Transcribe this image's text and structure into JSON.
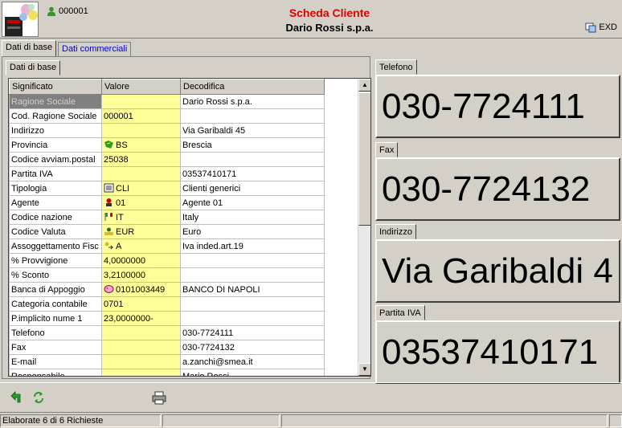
{
  "header": {
    "user_code": "000001",
    "title": "Scheda Cliente",
    "subtitle": "Dario Rossi s.p.a.",
    "exd_label": "EXD"
  },
  "tabs": [
    {
      "label": "Dati di base",
      "active": true
    },
    {
      "label": "Dati commerciali",
      "active": false
    }
  ],
  "left": {
    "subtab": "Dati di base",
    "columns": [
      "Significato",
      "Valore",
      "Decodifica"
    ],
    "rows": [
      {
        "sig": "Ragione Sociale",
        "val": "",
        "dec": "Dario Rossi s.p.a.",
        "icon": ""
      },
      {
        "sig": "Cod. Ragione Sociale",
        "val": "000001",
        "dec": "",
        "icon": ""
      },
      {
        "sig": "Indirizzo",
        "val": "",
        "dec": "Via Garibaldi 45",
        "icon": ""
      },
      {
        "sig": "Provincia",
        "val": "BS",
        "dec": "Brescia",
        "icon": "map-icon"
      },
      {
        "sig": "Codice avviam.postal",
        "val": "25038",
        "dec": "",
        "icon": ""
      },
      {
        "sig": "Partita IVA",
        "val": "",
        "dec": "03537410171",
        "icon": ""
      },
      {
        "sig": "Tipologia",
        "val": "CLI",
        "dec": "Clienti generici",
        "icon": "list-icon"
      },
      {
        "sig": "Agente",
        "val": "01",
        "dec": "Agente 01",
        "icon": "agent-icon"
      },
      {
        "sig": "Codice nazione",
        "val": "IT",
        "dec": "Italy",
        "icon": "flag-icon"
      },
      {
        "sig": "Codice Valuta",
        "val": "EUR",
        "dec": "Euro",
        "icon": "money-icon"
      },
      {
        "sig": "Assoggettamento Fisc",
        "val": "A",
        "dec": "Iva inded.art.19",
        "icon": "tax-icon"
      },
      {
        "sig": "% Provvigione",
        "val": "4,0000000",
        "dec": "",
        "icon": ""
      },
      {
        "sig": "% Sconto",
        "val": "3,2100000",
        "dec": "",
        "icon": ""
      },
      {
        "sig": "Banca di Appoggio",
        "val": "0101003449",
        "dec": "BANCO DI NAPOLI",
        "icon": "bank-icon"
      },
      {
        "sig": "Categoria contabile",
        "val": "0701",
        "dec": "",
        "icon": ""
      },
      {
        "sig": "P.implicito nume 1",
        "val": "23,0000000-",
        "dec": "",
        "icon": ""
      },
      {
        "sig": "Telefono",
        "val": "",
        "dec": "030-7724111",
        "icon": ""
      },
      {
        "sig": "Fax",
        "val": "",
        "dec": "030-7724132",
        "icon": ""
      },
      {
        "sig": "E-mail",
        "val": "",
        "dec": "a.zanchi@smea.it",
        "icon": ""
      },
      {
        "sig": "Responsabile",
        "val": "",
        "dec": "Mario Rossi",
        "icon": ""
      }
    ]
  },
  "right": {
    "telefono_label": "Telefono",
    "telefono_value": "030-7724111",
    "fax_label": "Fax",
    "fax_value": "030-7724132",
    "indirizzo_label": "Indirizzo",
    "indirizzo_value": "Via Garibaldi 4",
    "piva_label": "Partita IVA",
    "piva_value": "03537410171"
  },
  "status": {
    "message": "Elaborate 6 di 6 Richieste",
    "cell2": "",
    "cell3": "",
    "cell4": ""
  }
}
